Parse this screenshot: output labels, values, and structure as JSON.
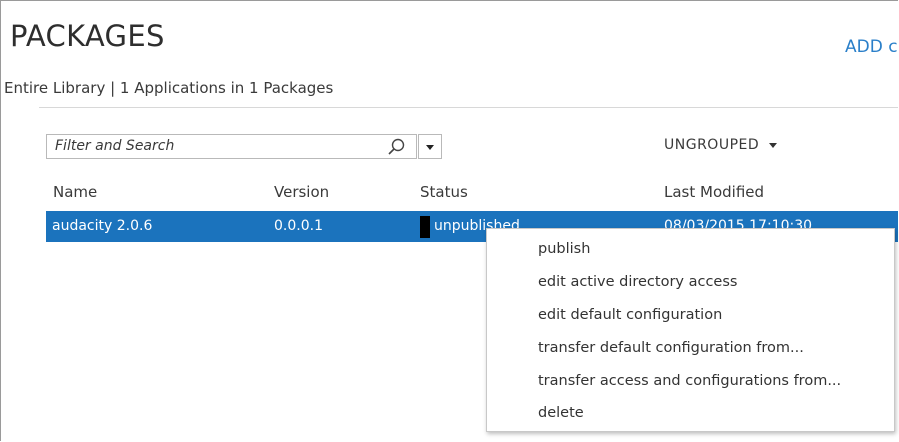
{
  "header": {
    "title": "PACKAGES",
    "add_link": "ADD c",
    "subtitle": "Entire Library | 1 Applications in 1 Packages"
  },
  "toolbar": {
    "search_placeholder": "Filter and Search",
    "search_icon": "search-icon",
    "grouping": "UNGROUPED"
  },
  "table": {
    "columns": [
      "Name",
      "Version",
      "Status",
      "Last Modified"
    ],
    "rows": [
      {
        "name": "audacity 2.0.6",
        "version": "0.0.0.1",
        "status": "unpublished",
        "modified": "08/03/2015 17:10:30"
      }
    ]
  },
  "context_menu": {
    "items": [
      "publish",
      "edit active directory access",
      "edit default configuration",
      "transfer default configuration from...",
      "transfer access and configurations from...",
      "delete"
    ]
  },
  "colors": {
    "selection": "#1b73bd",
    "link": "#2a7fc9"
  }
}
